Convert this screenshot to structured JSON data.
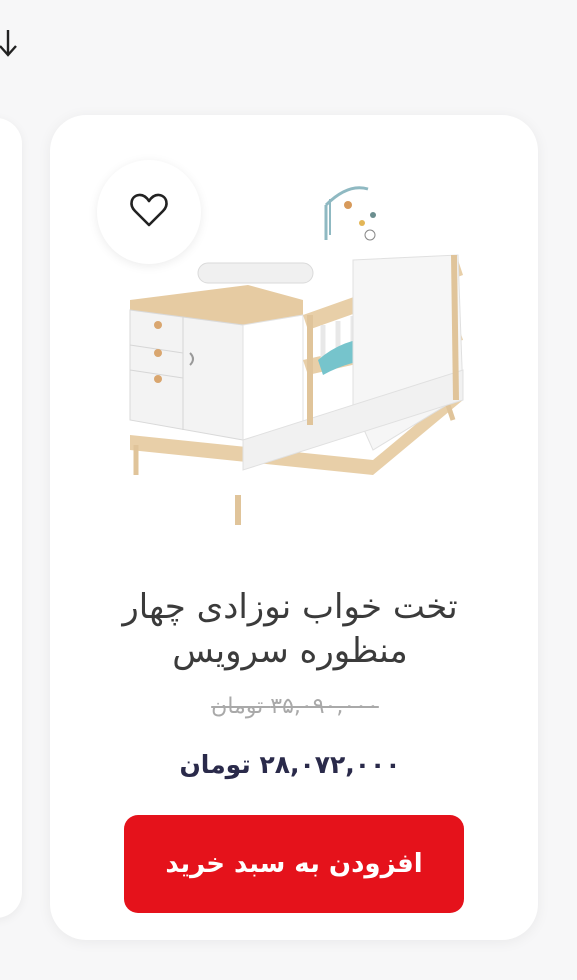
{
  "product": {
    "title": "تخت خواب نوزادی چهار منظوره سرویس",
    "old_price": "۳۵,۰۹۰,۰۰۰ تومان",
    "price": "۲۸,۰۷۲,۰۰۰ تومان",
    "add_to_cart_label": "افزودن به سبد خرید",
    "image_subject": "baby crib with drawers"
  },
  "icons": {
    "wishlist": "heart-icon",
    "scroll": "arrow-down-icon"
  },
  "colors": {
    "accent": "#e5121b",
    "price_text": "#2a2a4a",
    "old_price_text": "#a9a9a9",
    "title_text": "#3b3b3b"
  }
}
